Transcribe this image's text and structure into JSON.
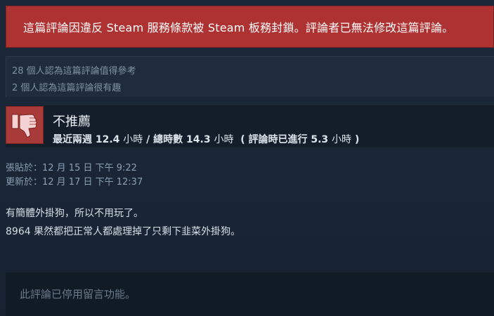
{
  "banner": {
    "text": "這篇評論因違反 Steam 服務條款被 Steam 板務封鎖。評論者已無法修改這篇評論。",
    "color": "#ae3232"
  },
  "helpful": {
    "helpful_text": "28 個人認為這篇評論值得參考",
    "funny_text": "2 個人認為這篇評論很有趣"
  },
  "review": {
    "icon": "thumbs-down-icon",
    "verdict": "不推薦",
    "recent_label": "最近兩週",
    "recent_hours": "12.4",
    "hours_unit_1": "小時",
    "sep": "/",
    "total_label": "總時數",
    "total_hours": "14.3",
    "hours_unit_2": "小時",
    "at_review_open": "(",
    "at_review_label": "評論時已進行",
    "at_review_hours": "5.3",
    "hours_unit_3": "小時",
    "at_review_close": ")"
  },
  "dates": {
    "posted": "張貼於：12 月 15 日 下午 9:22",
    "updated": "更新於：12 月 17 日 下午 12:37"
  },
  "body": {
    "line1": "有簡體外掛狗，所以不用玩了。",
    "line2": "8964 果然都把正常人都處理掉了只剩下韭菜外掛狗。"
  },
  "comments": {
    "disabled_text": "此評論已停用留言功能。"
  }
}
